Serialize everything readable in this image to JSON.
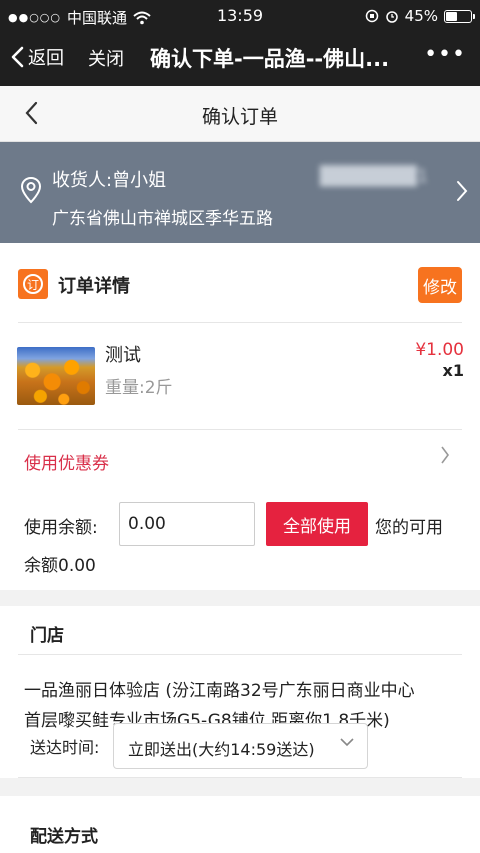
{
  "status_bar": {
    "carrier": "中国联通",
    "time": "13:59",
    "battery": "45%",
    "battery_level": 0.45
  },
  "wechat_bar": {
    "back_label": "返回",
    "close_label": "关闭",
    "title": "确认下单-一品渔--佛山..."
  },
  "page": {
    "title": "确认订单"
  },
  "address": {
    "recipient": "收货人:曾小姐",
    "phone_masked": "1",
    "detail": "广东省佛山市禅城区季华五路"
  },
  "order": {
    "title": "订单详情",
    "badge_char": "订",
    "edit_label": "修改",
    "product": {
      "name": "测试",
      "weight": "重量:2斤",
      "price": "¥1.00",
      "quantity": "x1"
    },
    "coupon_label": "使用优惠券",
    "balance": {
      "label": "使用余额:",
      "input_value": "0.00",
      "use_all_label": "全部使用",
      "available_part1": "您的可用",
      "available_part2": "余额0.00"
    }
  },
  "store": {
    "title": "门店",
    "text": "一品渔丽日体验店 (汾江南路32号广东丽日商业中心首层嚟买鲑专业市场G5-G8铺位,距离你1.8千米)",
    "delivery_label": "送达时间:",
    "delivery_value": "立即送出(大约14:59送达)"
  },
  "shipping": {
    "title": "配送方式"
  },
  "colors": {
    "orange": "#f7731f",
    "red": "#e5223f",
    "address_bg": "#6e7a8a",
    "dark_bar": "#1f1f1f"
  }
}
